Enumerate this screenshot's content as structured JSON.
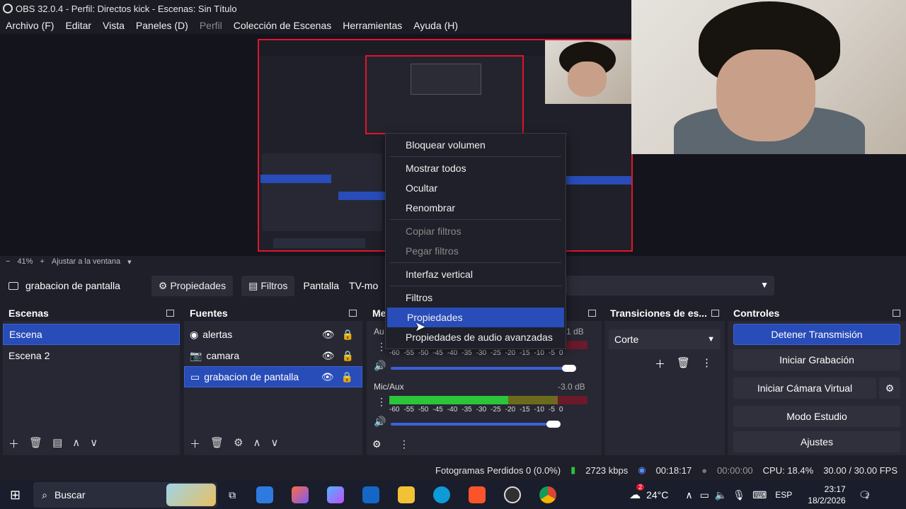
{
  "window": {
    "title": "OBS 32.0.4 - Perfil: Directos kick - Escenas: Sin Título"
  },
  "menu": [
    {
      "label": "Archivo (F)",
      "disabled": false
    },
    {
      "label": "Editar",
      "disabled": false
    },
    {
      "label": "Vista",
      "disabled": false
    },
    {
      "label": "Paneles (D)",
      "disabled": false
    },
    {
      "label": "Perfil",
      "disabled": true
    },
    {
      "label": "Colección de Escenas",
      "disabled": false
    },
    {
      "label": "Herramientas",
      "disabled": false
    },
    {
      "label": "Ayuda (H)",
      "disabled": false
    }
  ],
  "zoom": {
    "minus": "−",
    "value": "41%",
    "plus": "+",
    "fit": "Ajustar a la ventana"
  },
  "sourcebar": {
    "source": "grabacion de pantalla",
    "properties": "Propiedades",
    "filters": "Filtros",
    "display_label": "Pantalla",
    "display_value": "TV-mo"
  },
  "scenes": {
    "title": "Escenas",
    "items": [
      "Escena",
      "Escena 2"
    ]
  },
  "sources": {
    "title": "Fuentes",
    "items": [
      "alertas",
      "camara",
      "grabacion de pantalla"
    ]
  },
  "mixer": {
    "title": "Me",
    "ch1": {
      "name": "Au",
      "db": "1 dB"
    },
    "ch2": {
      "name": "Mic/Aux",
      "db": "-3.0 dB"
    },
    "ticks": [
      "-60",
      "-55",
      "-50",
      "-45",
      "-40",
      "-35",
      "-30",
      "-25",
      "-20",
      "-15",
      "-10",
      "-5",
      "0"
    ]
  },
  "transitions": {
    "title": "Transiciones de es...",
    "value": "Corte"
  },
  "controls": {
    "title": "Controles",
    "buttons": [
      "Detener Transmisión",
      "Iniciar Grabación",
      "Iniciar Cámara Virtual",
      "Modo Estudio",
      "Ajustes"
    ]
  },
  "context_menu": {
    "items": [
      {
        "label": "Bloquear volumen",
        "state": "normal"
      },
      {
        "label": "Mostrar todos",
        "state": "normal"
      },
      {
        "label": "Ocultar",
        "state": "normal"
      },
      {
        "label": "Renombrar",
        "state": "normal"
      },
      {
        "label": "Copiar filtros",
        "state": "disabled"
      },
      {
        "label": "Pegar filtros",
        "state": "disabled"
      },
      {
        "label": "Interfaz vertical",
        "state": "normal"
      },
      {
        "label": "Filtros",
        "state": "normal"
      },
      {
        "label": "Propiedades",
        "state": "highlighted"
      },
      {
        "label": "Propiedades de audio avanzadas",
        "state": "normal"
      }
    ]
  },
  "status": {
    "dropped": "Fotogramas Perdidos 0 (0.0%)",
    "kbps": "2723 kbps",
    "stream_time": "00:18:17",
    "rec_time": "00:00:00",
    "cpu": "CPU: 18.4%",
    "fps": "30.00 / 30.00 FPS"
  },
  "taskbar": {
    "search": "Buscar",
    "weather": "24°C",
    "lang": "ESP",
    "time": "23:17",
    "date": "18/2/2026",
    "weather_badge": "2",
    "notif_badge": "2"
  },
  "colors": {
    "accent": "#284cb8",
    "red_border": "#e2142a",
    "meter_green": "#2bc43a"
  }
}
